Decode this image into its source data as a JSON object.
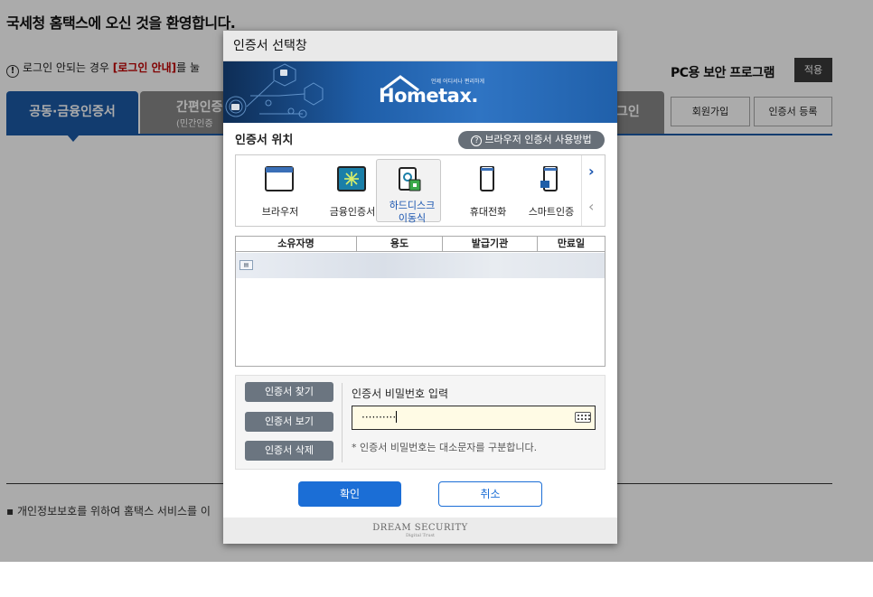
{
  "page": {
    "welcome": "국세청 홈택스에 오신 것을 환영합니다.",
    "login_help_prefix": "로그인 안되는 경우 ",
    "login_help_link": "[로그인 안내]",
    "login_help_suffix": "를 눌",
    "pc_security": "PC용 보안 프로그램",
    "apply_label": "적용",
    "tabs": {
      "joint_cert": "공동·금융인증서",
      "simple_auth": "간편인증",
      "simple_auth_sub": "(민간인증",
      "right_tab": "그인"
    },
    "signup_label": "회원가입",
    "register_cert_label": "인증서 등록",
    "privacy": "개인정보보호를 위하여 홈택스 서비스를 이"
  },
  "modal": {
    "title": "인증서 선택창",
    "banner": {
      "brand_small": "언제 어디서나 편리하게",
      "brand_main": "Hometax."
    },
    "location_label": "인증서 위치",
    "help_button": "브라우저 인증서 사용방법",
    "stores": [
      {
        "label": "브라우저",
        "icon": "browser-icon"
      },
      {
        "label": "금융인증서",
        "icon": "financial-cert-icon"
      },
      {
        "label": "하드디스크",
        "label2": "이동식",
        "icon": "hard-disk-icon",
        "selected": true
      },
      {
        "label": "휴대전화",
        "icon": "mobile-phone-icon"
      },
      {
        "label": "스마트인증",
        "icon": "smart-auth-icon"
      }
    ],
    "table": {
      "headers": [
        "소유자명",
        "용도",
        "발급기관",
        "만료일"
      ]
    },
    "password": {
      "find_button": "인증서 찾기",
      "view_button": "인증서 보기",
      "delete_button": "인증서 삭제",
      "label": "인증서 비밀번호 입력",
      "masked_value": "··········",
      "note": "* 인증서 비밀번호는 대소문자를 구분합니다."
    },
    "ok_button": "확인",
    "cancel_button": "취소",
    "footer": {
      "brand": "DREAM SECURITY",
      "tagline": "Digital Trust"
    }
  },
  "colors": {
    "accent_blue": "#1b5aa6",
    "ok_blue": "#1b6ed6",
    "grey_button": "#6b7580"
  }
}
